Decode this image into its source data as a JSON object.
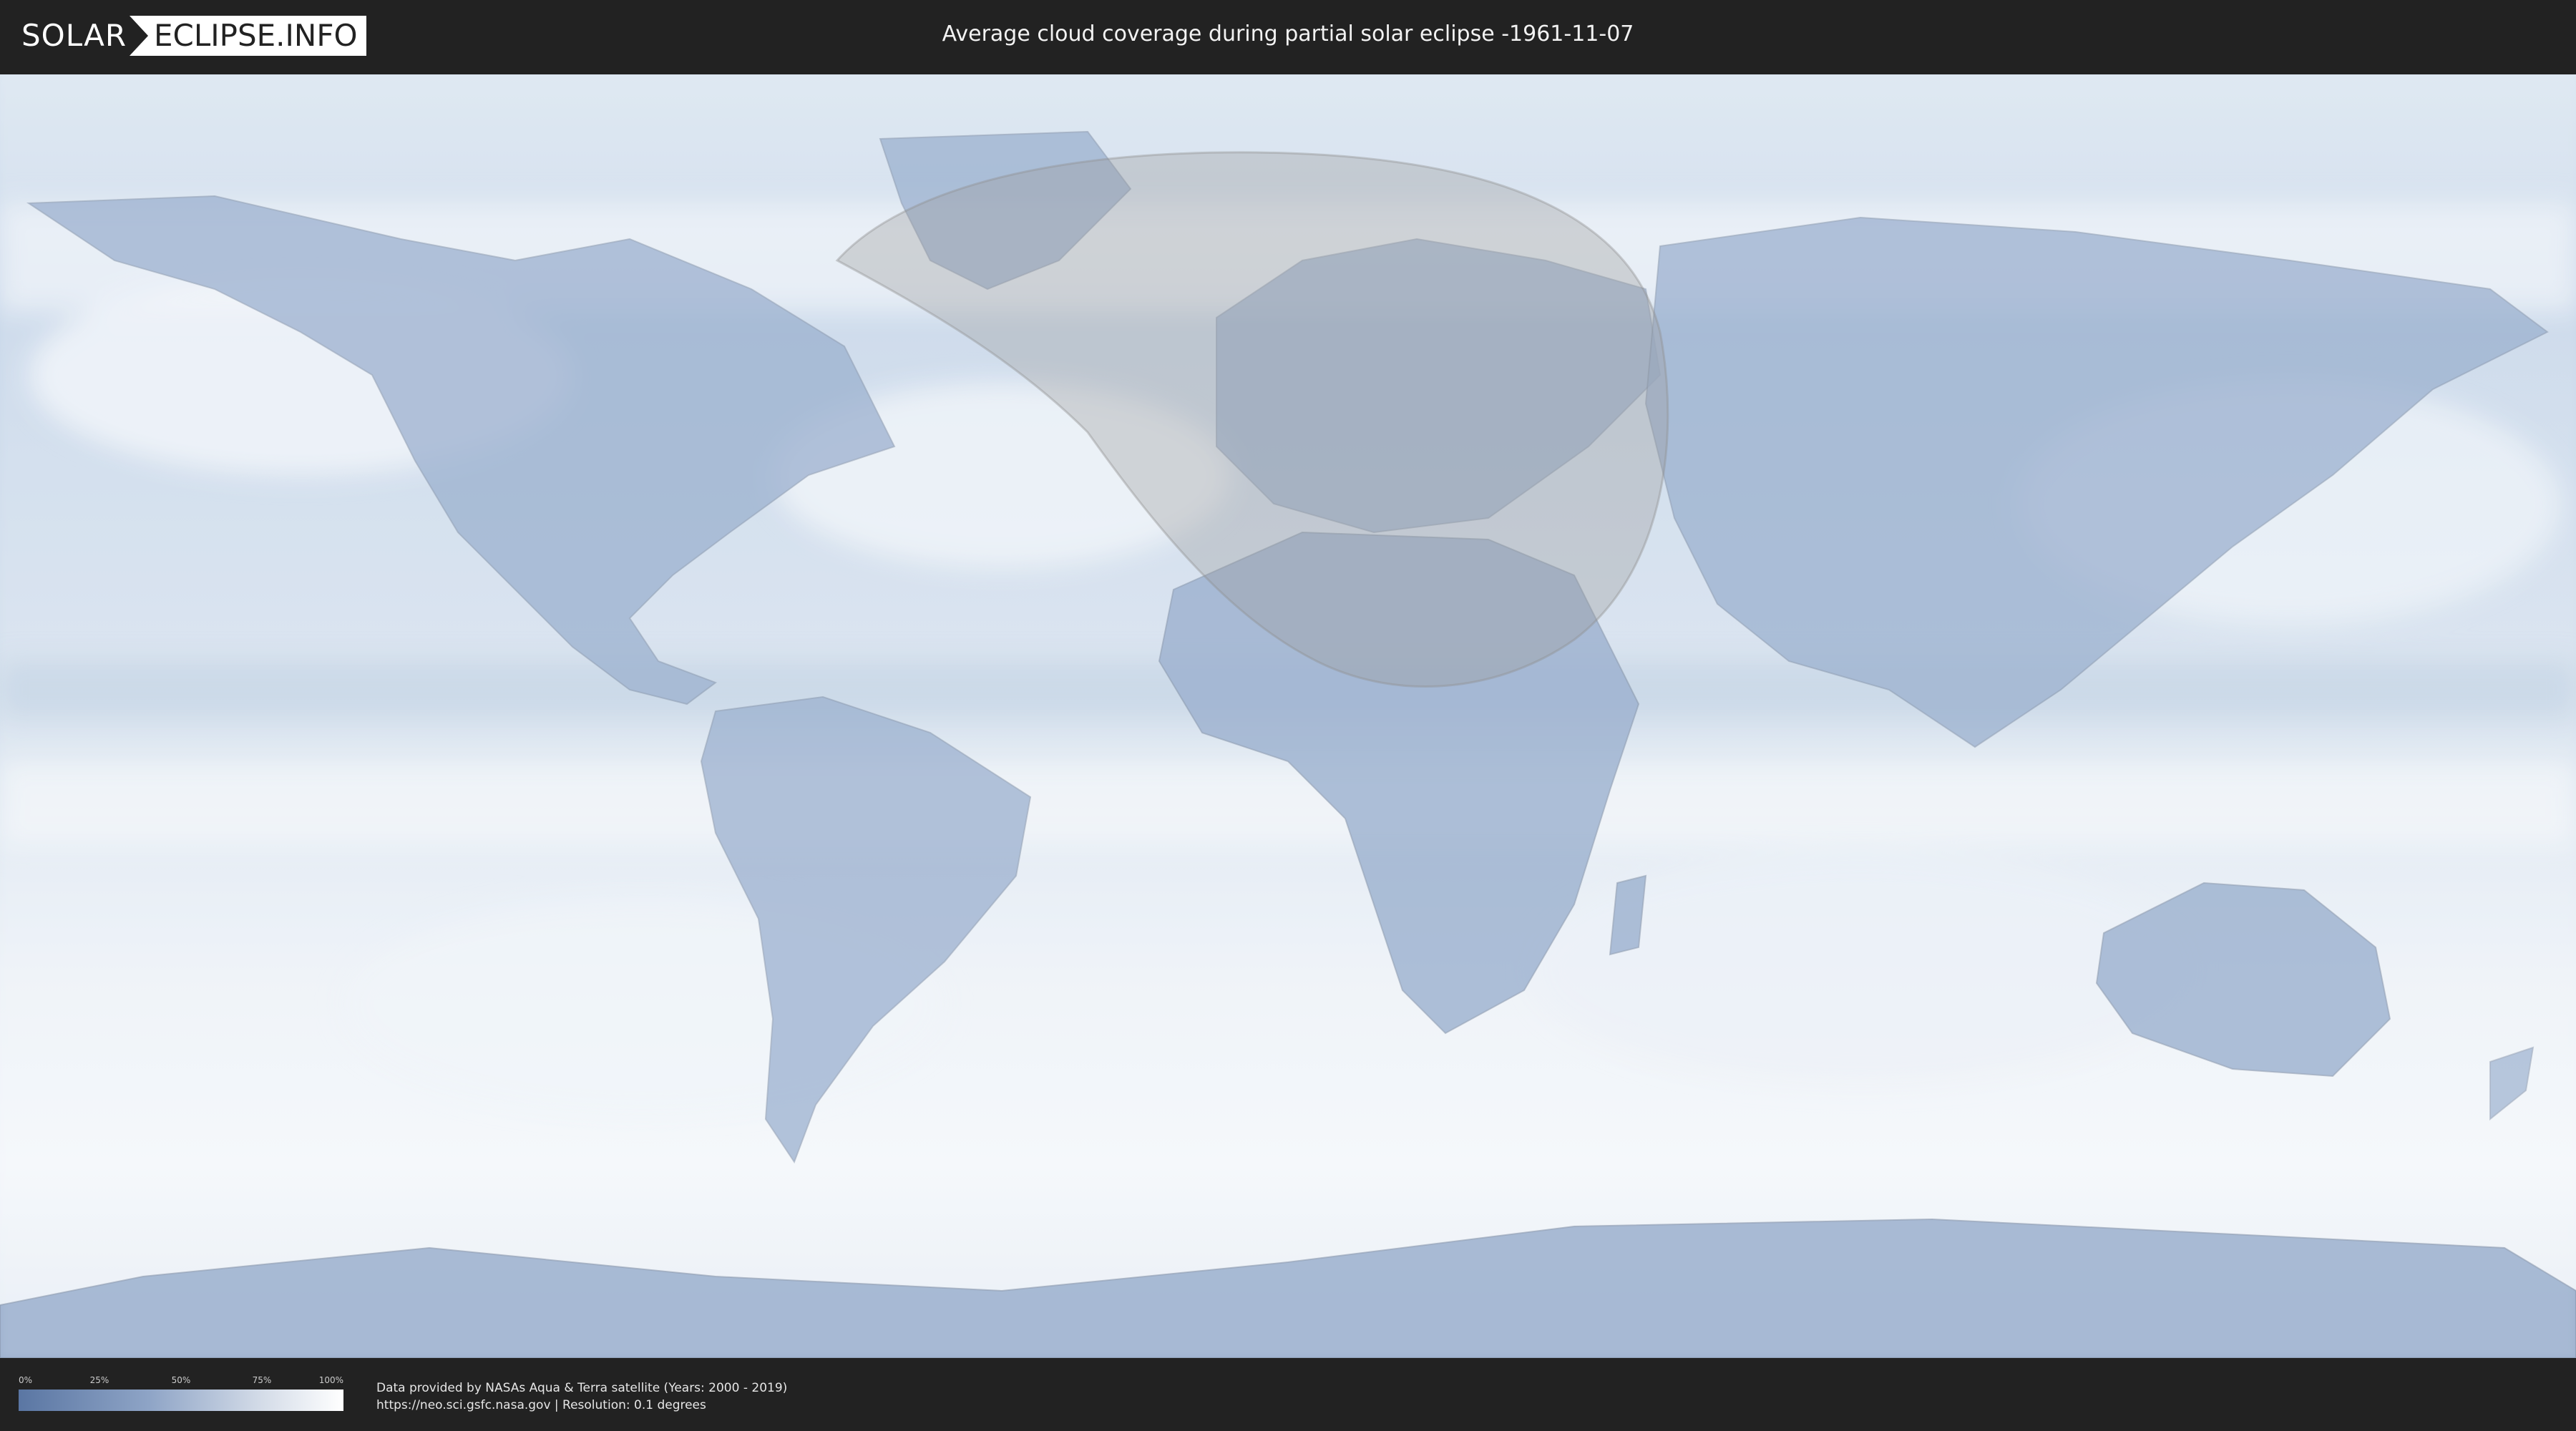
{
  "header": {
    "logo_left": "SOLAR",
    "logo_right": "ECLIPSE.INFO",
    "title": "Average cloud coverage during partial solar eclipse -1961-11-07"
  },
  "map": {
    "projection": "equirectangular",
    "eclipse_visibility_region": "North Atlantic, Greenland, Europe, North Africa, Arabian Peninsula"
  },
  "legend": {
    "ticks": [
      "0%",
      "25%",
      "50%",
      "75%",
      "100%"
    ],
    "colors": {
      "low": "#5a76a3",
      "high": "#ffffff"
    }
  },
  "credits": {
    "line1": "Data provided by NASAs Aqua & Terra satellite (Years: 2000 - 2019)",
    "line2": "https://neo.sci.gsfc.nasa.gov | Resolution: 0.1 degrees"
  },
  "colors": {
    "background": "#222222",
    "ocean_clouds": "#dfe8f2",
    "land_clear": "#7d96bd",
    "eclipse_shade": "#9a9a9a"
  }
}
